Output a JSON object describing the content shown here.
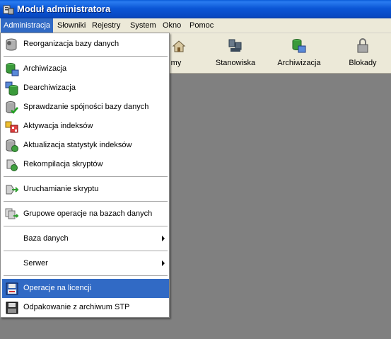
{
  "window": {
    "title": "Moduł administratora"
  },
  "menubar": {
    "items": [
      "Administracja",
      "Słowniki",
      "Rejestry",
      "System",
      "Okno",
      "Pomoc"
    ]
  },
  "toolbar": {
    "partial_label": "my",
    "buttons": [
      "Stanowiska",
      "Archiwizacja",
      "Blokady"
    ]
  },
  "menu": {
    "items": [
      {
        "label": "Reorganizacja bazy danych",
        "icon": "database-gear-icon"
      },
      {
        "label": "Archiwizacja",
        "icon": "database-archive-icon"
      },
      {
        "label": "Dearchiwizacja",
        "icon": "database-restore-icon"
      },
      {
        "label": "Sprawdzanie spójności bazy danych",
        "icon": "database-check-icon"
      },
      {
        "label": "Aktywacja indeksów",
        "icon": "index-activate-icon"
      },
      {
        "label": "Aktualizacja statystyk indeksów",
        "icon": "database-stats-icon"
      },
      {
        "label": "Rekompilacja skryptów",
        "icon": "script-compile-icon"
      },
      {
        "label": "Uruchamianie skryptu",
        "icon": "script-run-icon"
      },
      {
        "label": "Grupowe operacje na bazach danych",
        "icon": "group-operations-icon"
      },
      {
        "label": "Baza danych",
        "icon": ""
      },
      {
        "label": "Serwer",
        "icon": ""
      },
      {
        "label": "Operacje na licencji",
        "icon": "license-disk-icon"
      },
      {
        "label": "Odpakowanie z archiwum STP",
        "icon": "archive-unpack-icon"
      }
    ]
  },
  "colors": {
    "highlight": "#316ac5",
    "titlebar": "#0b56d6",
    "face": "#ece9d8",
    "workspace": "#808080"
  }
}
